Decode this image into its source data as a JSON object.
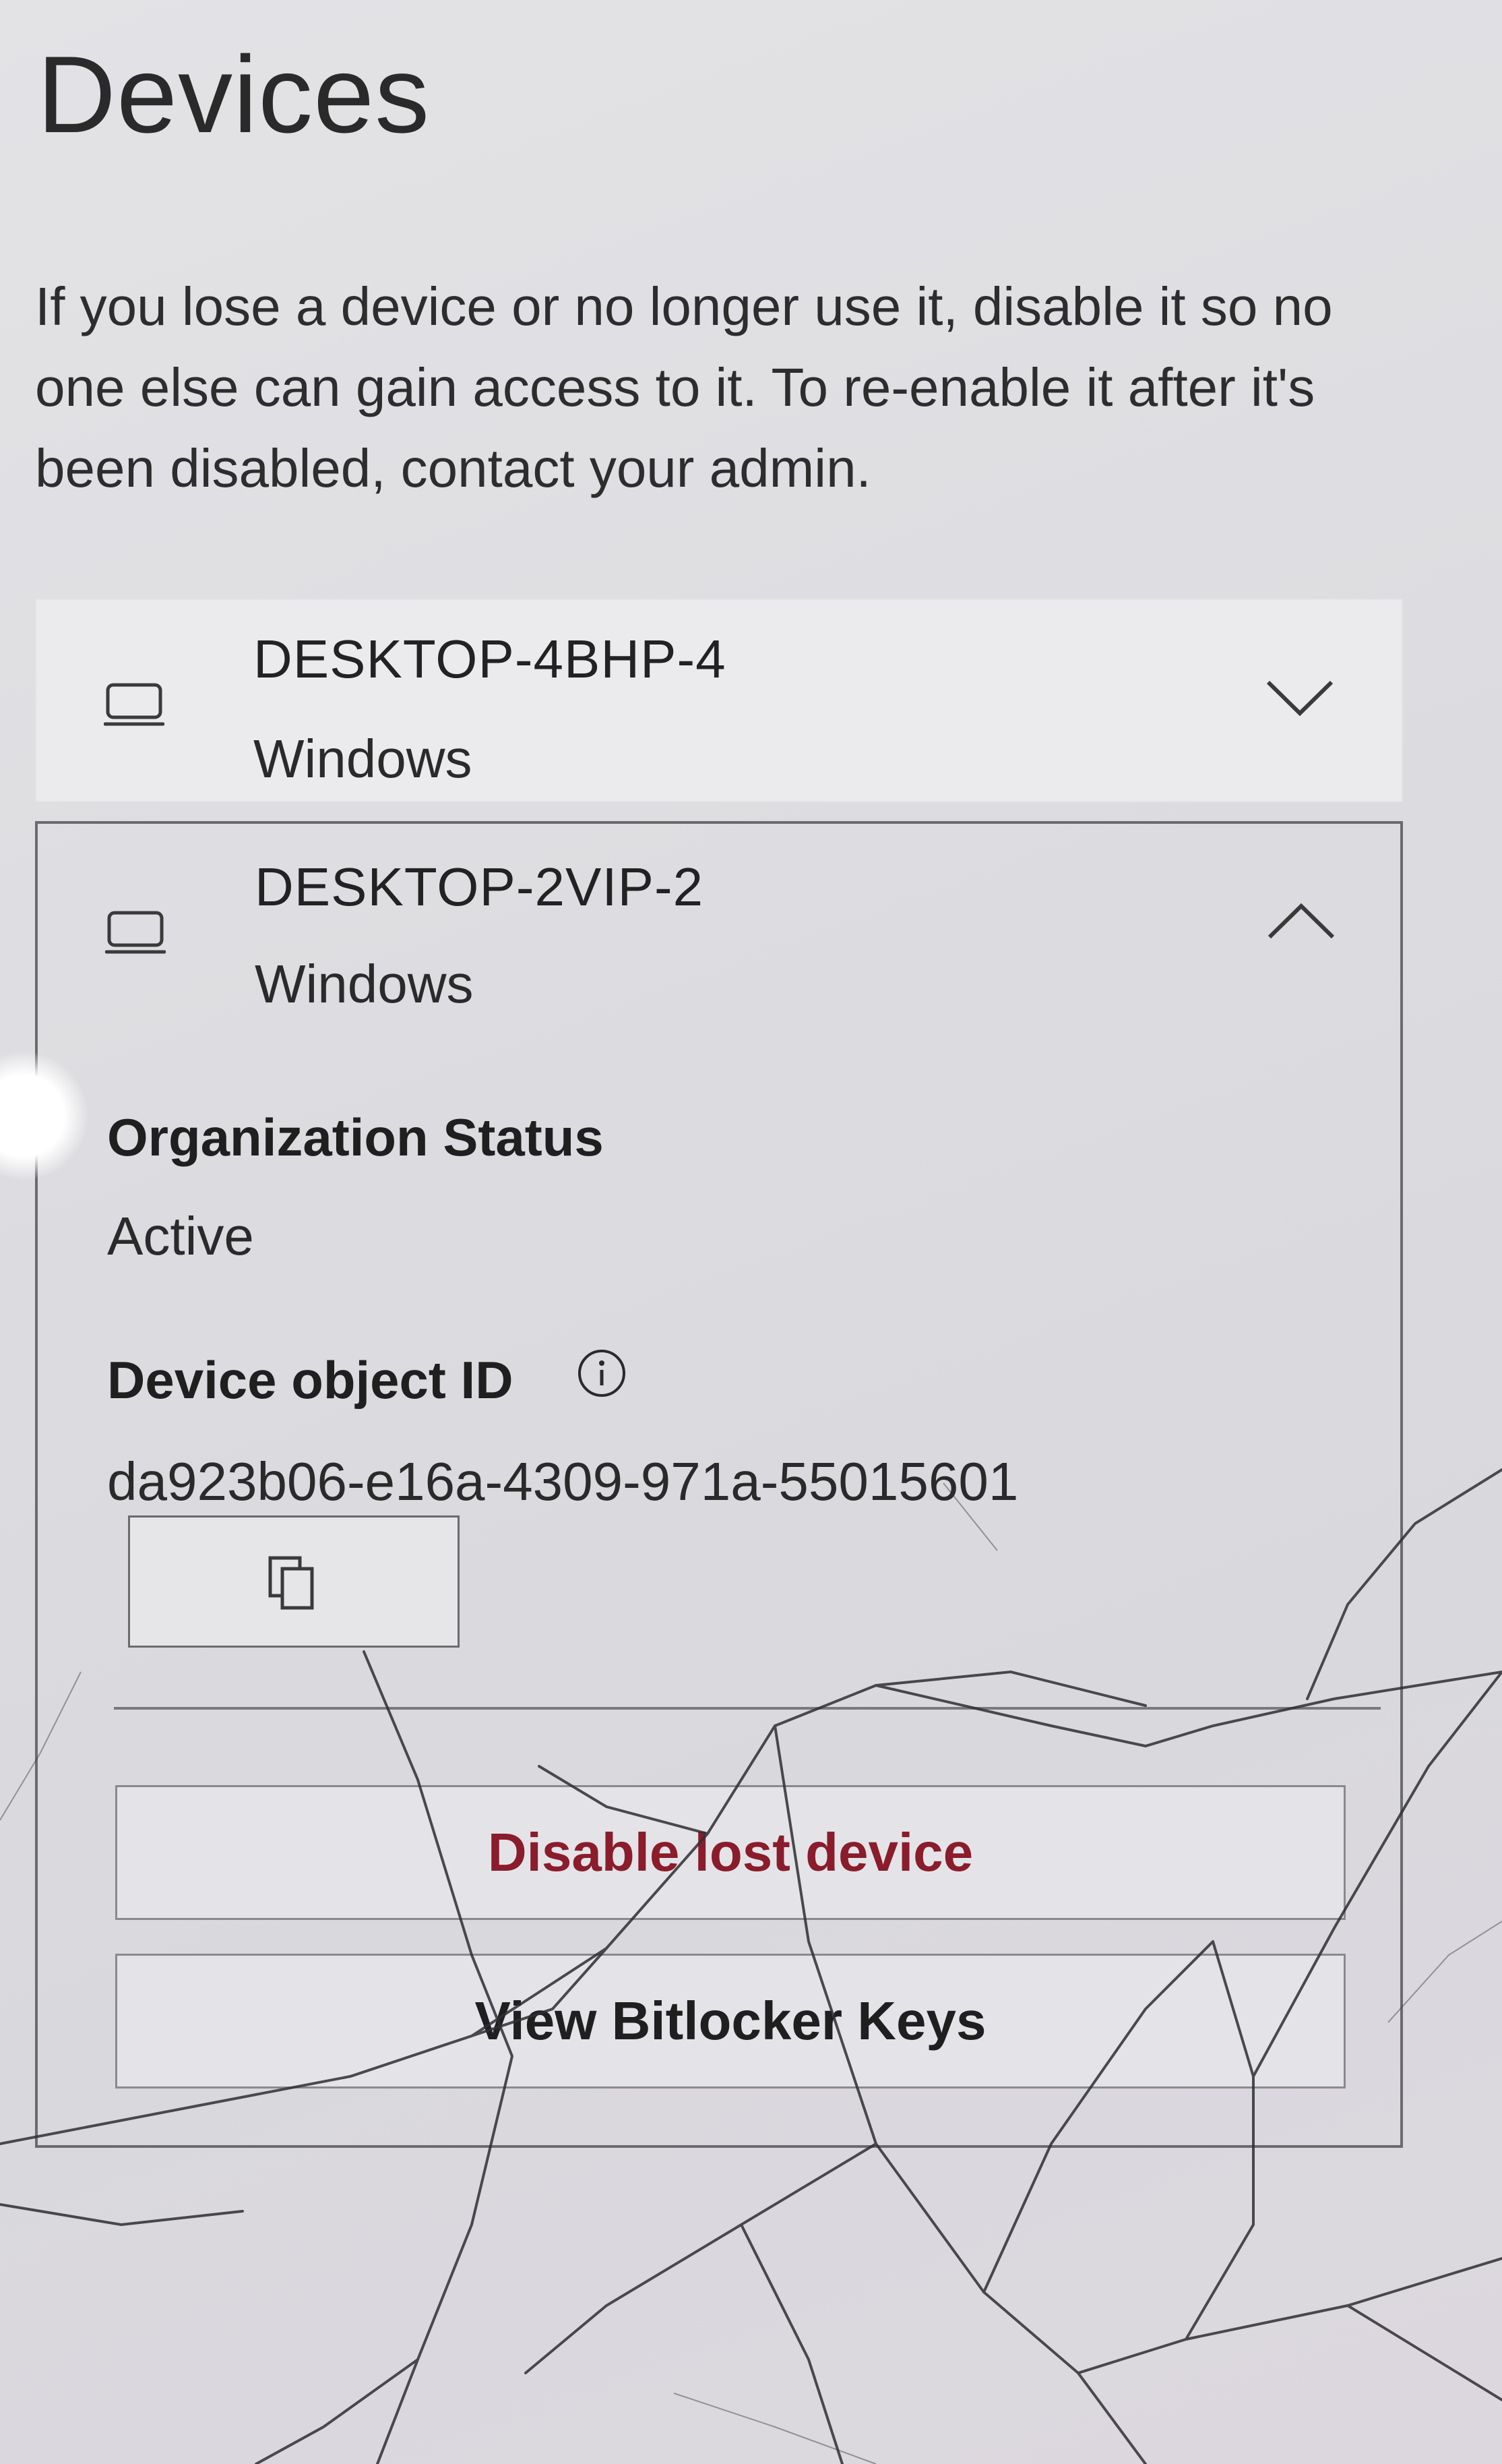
{
  "page": {
    "title": "Devices",
    "intro_text": "If you lose a device or no longer use it, disable it so no one else can gain access to it. To re-enable it after it's been disabled, contact your admin."
  },
  "devices": [
    {
      "name": "DESKTOP-4BHP-4",
      "os": "Windows",
      "icon": "laptop-icon",
      "expand_icon": "chevron-down-icon",
      "expanded": false
    },
    {
      "name": "DESKTOP-2VIP-2",
      "os": "Windows",
      "icon": "laptop-icon",
      "expand_icon": "chevron-up-icon",
      "expanded": true,
      "details": {
        "org_status_label": "Organization Status",
        "org_status_value": "Active",
        "object_id_label": "Device object ID",
        "object_id_info_icon": "info-icon",
        "object_id_value": "da923b06-e16a-4309-971a-55015601",
        "copy_icon": "copy-icon",
        "disable_button": "Disable lost device",
        "bitlocker_button": "View Bitlocker Keys"
      }
    }
  ],
  "colors": {
    "danger_text": "#8a1c2b",
    "border": "#6b6b6f"
  }
}
